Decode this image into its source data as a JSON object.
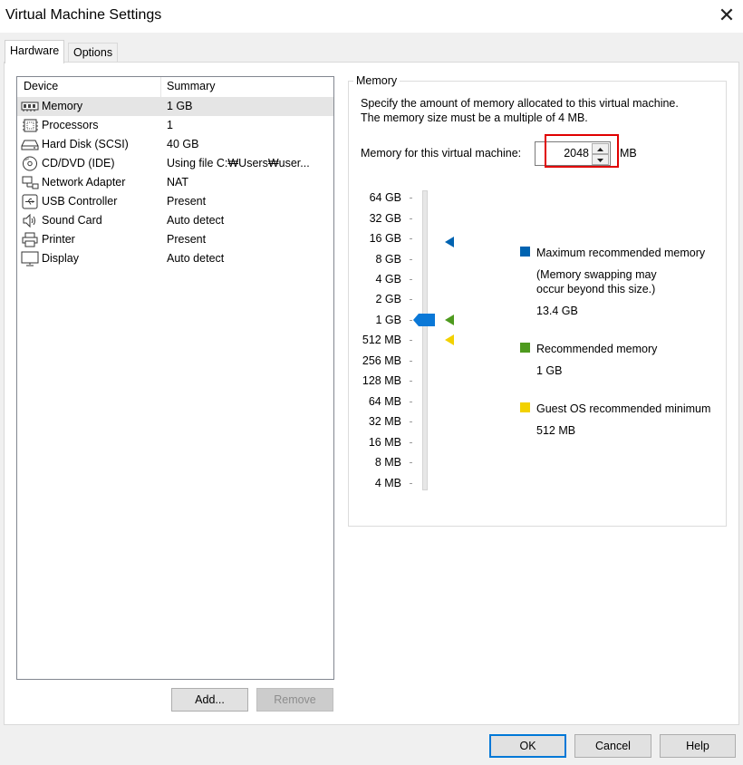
{
  "window": {
    "title": "Virtual Machine Settings",
    "close_glyph": "✕"
  },
  "tabs": [
    {
      "label": "Hardware"
    },
    {
      "label": "Options"
    }
  ],
  "device_list": {
    "columns": {
      "device": "Device",
      "summary": "Summary"
    },
    "items": [
      {
        "name": "Memory",
        "summary": "1 GB",
        "icon": "memory-icon",
        "selected": true
      },
      {
        "name": "Processors",
        "summary": "1",
        "icon": "processor-icon"
      },
      {
        "name": "Hard Disk (SCSI)",
        "summary": "40 GB",
        "icon": "hard-disk-icon"
      },
      {
        "name": "CD/DVD (IDE)",
        "summary": "Using file C:₩Users₩user...",
        "icon": "cd-dvd-icon"
      },
      {
        "name": "Network Adapter",
        "summary": "NAT",
        "icon": "network-adapter-icon"
      },
      {
        "name": "USB Controller",
        "summary": "Present",
        "icon": "usb-icon"
      },
      {
        "name": "Sound Card",
        "summary": "Auto detect",
        "icon": "speaker-icon"
      },
      {
        "name": "Printer",
        "summary": "Present",
        "icon": "printer-icon"
      },
      {
        "name": "Display",
        "summary": "Auto detect",
        "icon": "display-icon"
      }
    ],
    "add_label": "Add...",
    "remove_label": "Remove"
  },
  "memory": {
    "group_title": "Memory",
    "description_line1": "Specify the amount of memory allocated to this virtual machine.",
    "description_line2": "The memory size must be a multiple of 4 MB.",
    "field_label": "Memory for this virtual machine:",
    "value": "2048",
    "unit": "MB",
    "scale_labels": [
      "64 GB",
      "32 GB",
      "16 GB",
      "8 GB",
      "4 GB",
      "2 GB",
      "1 GB",
      "512 MB",
      "256 MB",
      "128 MB",
      "64 MB",
      "32 MB",
      "16 MB",
      "8 MB",
      "4 MB"
    ],
    "legend": {
      "max": {
        "title": "Maximum recommended memory",
        "note_line1": "(Memory swapping may",
        "note_line2": "occur beyond this size.)",
        "value": "13.4 GB",
        "color": "#0063b1"
      },
      "recommended": {
        "title": "Recommended memory",
        "value": "1 GB",
        "color": "#4e9a1e"
      },
      "guest_min": {
        "title": "Guest OS recommended minimum",
        "value": "512 MB",
        "color": "#f2d100"
      }
    }
  },
  "footer": {
    "ok_label": "OK",
    "cancel_label": "Cancel",
    "help_label": "Help"
  }
}
